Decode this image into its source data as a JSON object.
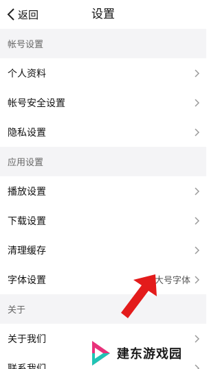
{
  "header": {
    "back_label": "返回",
    "title": "设置"
  },
  "sections": [
    {
      "title": "帐号设置",
      "items": [
        {
          "label": "个人资料"
        },
        {
          "label": "帐号安全设置"
        },
        {
          "label": "隐私设置"
        }
      ]
    },
    {
      "title": "应用设置",
      "items": [
        {
          "label": "播放设置"
        },
        {
          "label": "下载设置"
        },
        {
          "label": "清理缓存"
        },
        {
          "label": "字体设置",
          "value": "大号字体"
        }
      ]
    },
    {
      "title": "关于",
      "items": [
        {
          "label": "关于我们"
        },
        {
          "label": "联系我们"
        }
      ]
    }
  ],
  "watermark": {
    "text": "建东游戏园"
  },
  "colors": {
    "section_bg": "#f4f4f6",
    "chevron": "#999999",
    "annotation_arrow": "#e31b1b",
    "logo_pink": "#e8327a",
    "logo_teal": "#1fc4b4"
  }
}
